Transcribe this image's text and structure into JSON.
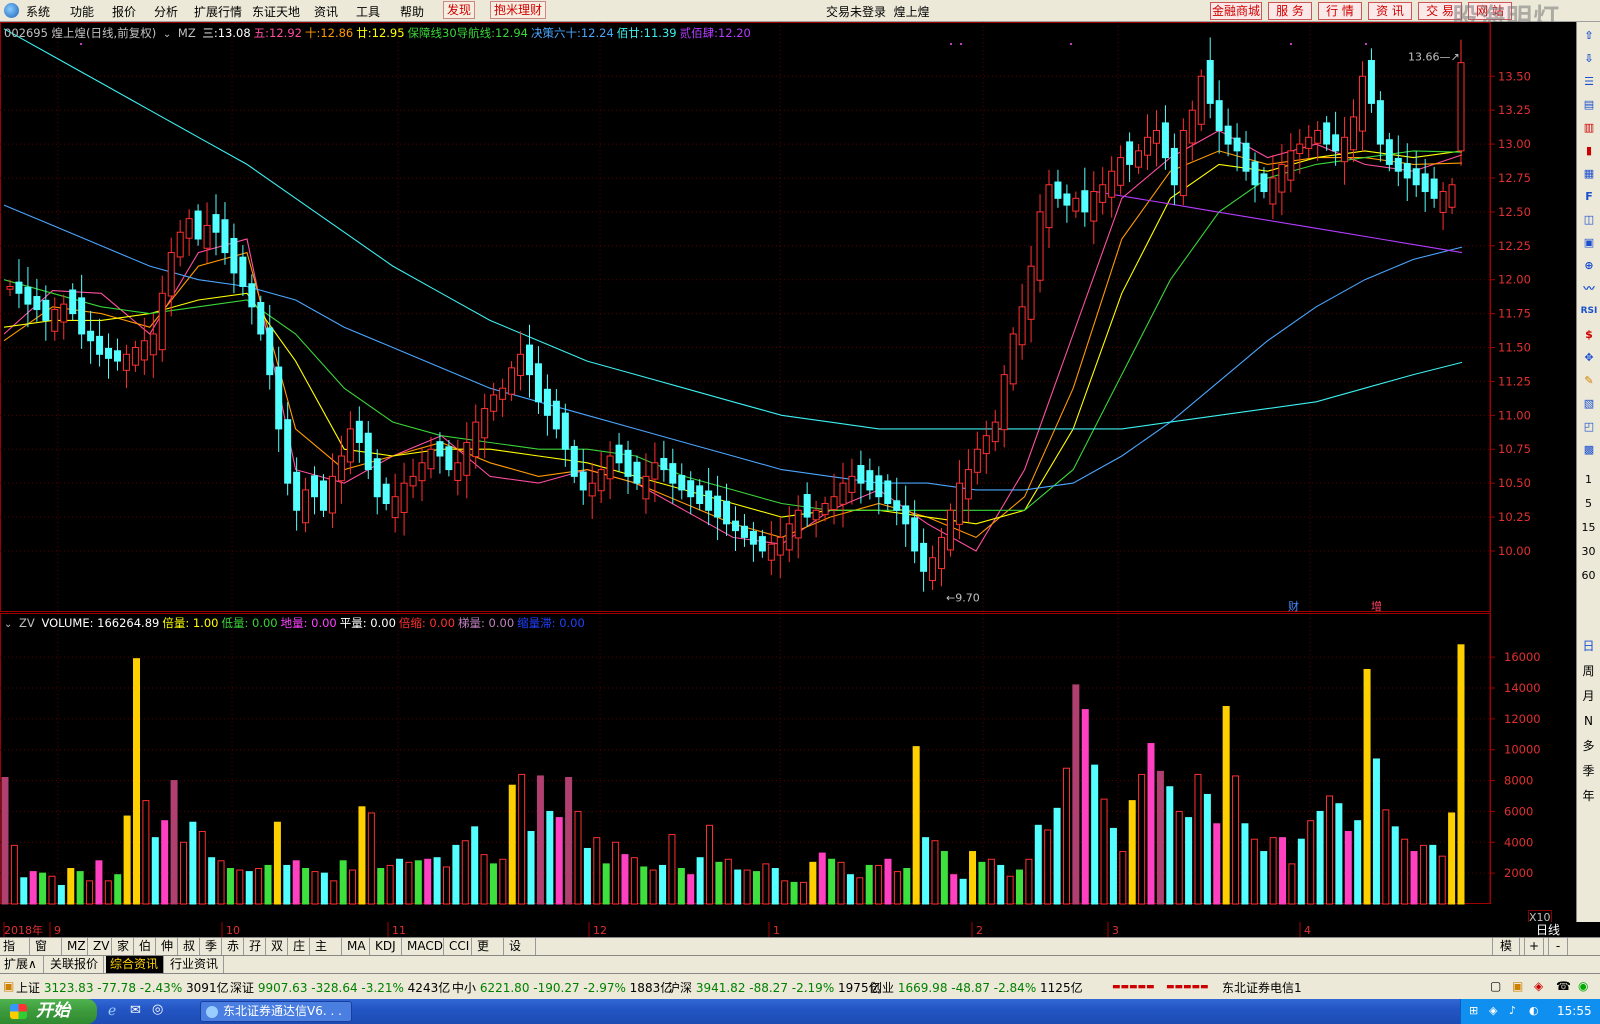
{
  "menu": {
    "items": [
      "系统",
      "功能",
      "报价",
      "分析",
      "扩展行情",
      "东证天地",
      "资讯",
      "工具",
      "帮助"
    ],
    "red_items": [
      "发现",
      "抱米理财"
    ],
    "login_status": "交易未登录",
    "stock_title": "煌上煌",
    "right_buttons": [
      "金融商城",
      "服 务",
      "行 情",
      "资 讯",
      "交 易",
      "网 站"
    ],
    "watermark": "股海明灯"
  },
  "price_legend": {
    "code_name": "002695 煌上煌(日线,前复权)",
    "indicator": "MZ",
    "items": [
      {
        "label": "三:",
        "value": "13.08",
        "color": "#ffffff"
      },
      {
        "label": "五:",
        "value": "12.92",
        "color": "#ff4fa0"
      },
      {
        "label": "十:",
        "value": "12.86",
        "color": "#ff9a00"
      },
      {
        "label": "廿:",
        "value": "12.95",
        "color": "#ffff00"
      },
      {
        "label": "保障线30导航线:",
        "value": "12.94",
        "color": "#39d539"
      },
      {
        "label": "决策六十:",
        "value": "12.24",
        "color": "#4aa6ff"
      },
      {
        "label": "佰廿:",
        "value": "11.39",
        "color": "#3cf0f0"
      },
      {
        "label": "贰佰肆:",
        "value": "12.20",
        "color": "#b43cff"
      }
    ]
  },
  "volume_legend": {
    "indicator": "ZV",
    "items": [
      {
        "label": "VOLUME:",
        "value": "166264.89",
        "color": "#ffffff"
      },
      {
        "label": "倍量:",
        "value": "1.00",
        "color": "#ffff00"
      },
      {
        "label": "低量:",
        "value": "0.00",
        "color": "#39d539"
      },
      {
        "label": "地量:",
        "value": "0.00",
        "color": "#ff40ff"
      },
      {
        "label": "平量:",
        "value": "0.00",
        "color": "#ffffff"
      },
      {
        "label": "倍缩:",
        "value": "0.00",
        "color": "#ff3030"
      },
      {
        "label": "梯量:",
        "value": "0.00",
        "color": "#c080c0"
      },
      {
        "label": "缩量滞:",
        "value": "0.00",
        "color": "#2040ff"
      }
    ],
    "multiplier": "X10"
  },
  "chart_data": [
    {
      "type": "candlestick",
      "title": "002695 煌上煌(日线,前复权)",
      "y_ticks": [
        "13.50",
        "13.25",
        "13.00",
        "12.75",
        "12.50",
        "12.25",
        "12.00",
        "11.75",
        "11.50",
        "11.25",
        "11.00",
        "10.75",
        "10.50",
        "10.25",
        "10.00"
      ],
      "ylim": [
        9.55,
        13.9
      ],
      "annotations": [
        {
          "text": "13.66",
          "price": 13.66
        },
        {
          "text": "9.70",
          "price": 9.7
        }
      ],
      "event_markers": [
        "财",
        "增"
      ],
      "closes": [
        11.95,
        11.9,
        11.82,
        11.78,
        11.7,
        11.78,
        11.82,
        11.75,
        11.6,
        11.55,
        11.45,
        11.42,
        11.4,
        11.45,
        11.5,
        11.55,
        11.6,
        11.9,
        12.2,
        12.35,
        12.45,
        12.3,
        12.4,
        12.35,
        12.2,
        12.05,
        11.95,
        11.8,
        11.6,
        11.3,
        10.9,
        10.5,
        10.3,
        10.45,
        10.4,
        10.3,
        10.55,
        10.7,
        10.9,
        10.8,
        10.6,
        10.4,
        10.35,
        10.4,
        10.5,
        10.55,
        10.65,
        10.75,
        10.7,
        10.6,
        10.65,
        10.8,
        10.95,
        11.05,
        11.15,
        11.2,
        11.35,
        11.45,
        11.3,
        11.1,
        11.0,
        10.9,
        10.75,
        10.55,
        10.45,
        10.5,
        10.6,
        10.7,
        10.65,
        10.55,
        10.5,
        10.55,
        10.65,
        10.6,
        10.5,
        10.45,
        10.4,
        10.35,
        10.3,
        10.25,
        10.2,
        10.15,
        10.1,
        10.05,
        10.0,
        10.05,
        10.1,
        10.2,
        10.3,
        10.25,
        10.3,
        10.35,
        10.4,
        10.5,
        10.55,
        10.5,
        10.45,
        10.4,
        10.35,
        10.3,
        10.2,
        10.0,
        9.85,
        9.95,
        10.1,
        10.3,
        10.5,
        10.6,
        10.75,
        10.85,
        10.95,
        11.3,
        11.6,
        11.8,
        12.1,
        12.5,
        12.7,
        12.6,
        12.55,
        12.6,
        12.5,
        12.65,
        12.7,
        12.8,
        12.9,
        12.85,
        12.95,
        13.05,
        13.1,
        12.9,
        12.7,
        13.1,
        13.25,
        13.5,
        13.3,
        13.1,
        13.0,
        12.95,
        12.8,
        12.7,
        12.65,
        12.75,
        12.85,
        12.95,
        13.0,
        13.05,
        13.1,
        13.0,
        12.95,
        13.05,
        13.2,
        13.5,
        13.3,
        13.0,
        12.85,
        12.8,
        12.75,
        12.7,
        12.65,
        12.6,
        12.65,
        12.7,
        13.6
      ],
      "ma_series": [
        {
          "name": "五",
          "values": [
            11.6,
            11.92,
            11.9,
            11.6,
            12.2,
            12.3,
            10.6,
            10.5,
            10.7,
            10.85,
            10.55,
            10.5,
            10.6,
            10.5,
            10.3,
            10.1,
            10.05,
            10.3,
            10.45,
            10.2,
            10.0,
            10.6,
            11.6,
            12.6,
            12.9,
            13.1,
            12.9,
            13.0,
            12.85,
            12.8,
            12.92
          ]
        },
        {
          "name": "十",
          "values": [
            11.55,
            11.8,
            11.75,
            11.65,
            12.1,
            12.2,
            10.9,
            10.6,
            10.7,
            10.8,
            10.65,
            10.55,
            10.6,
            10.5,
            10.35,
            10.2,
            10.1,
            10.25,
            10.35,
            10.25,
            10.1,
            10.4,
            11.2,
            12.3,
            12.8,
            12.95,
            12.85,
            12.9,
            12.9,
            12.85,
            12.86
          ]
        },
        {
          "name": "廿",
          "values": [
            11.65,
            11.7,
            11.7,
            11.75,
            11.85,
            11.9,
            11.4,
            10.75,
            10.7,
            10.75,
            10.75,
            10.7,
            10.65,
            10.55,
            10.45,
            10.35,
            10.25,
            10.3,
            10.3,
            10.25,
            10.2,
            10.3,
            10.9,
            11.9,
            12.6,
            12.85,
            12.8,
            12.9,
            12.95,
            12.9,
            12.95
          ]
        },
        {
          "name": "保障线30导航线",
          "values": [
            12.0,
            11.9,
            11.8,
            11.75,
            11.8,
            11.85,
            11.6,
            11.2,
            10.95,
            10.85,
            10.8,
            10.75,
            10.75,
            10.7,
            10.55,
            10.45,
            10.35,
            10.3,
            10.3,
            10.3,
            10.3,
            10.3,
            10.6,
            11.3,
            12.0,
            12.5,
            12.75,
            12.85,
            12.9,
            12.95,
            12.94
          ]
        },
        {
          "name": "决策六十",
          "values": [
            12.55,
            12.4,
            12.25,
            12.1,
            12.0,
            11.95,
            11.85,
            11.65,
            11.5,
            11.35,
            11.2,
            11.1,
            11.0,
            10.9,
            10.8,
            10.7,
            10.6,
            10.55,
            10.5,
            10.5,
            10.45,
            10.45,
            10.5,
            10.7,
            10.95,
            11.25,
            11.55,
            11.8,
            12.0,
            12.15,
            12.24
          ]
        },
        {
          "name": "佰廿",
          "values": [
            13.85,
            13.65,
            13.45,
            13.25,
            13.05,
            12.85,
            12.6,
            12.35,
            12.1,
            11.9,
            11.7,
            11.55,
            11.4,
            11.3,
            11.2,
            11.1,
            11.0,
            10.95,
            10.9,
            10.9,
            10.9,
            10.9,
            10.9,
            10.9,
            10.95,
            11.0,
            11.05,
            11.1,
            11.2,
            11.3,
            11.39
          ]
        },
        {
          "name": "贰佰肆",
          "values": [
            12.65,
            12.6,
            12.55,
            12.5,
            12.45,
            12.4,
            12.35,
            12.3,
            12.25,
            12.2
          ]
        }
      ]
    },
    {
      "type": "bar",
      "title": "VOLUME",
      "y_ticks": [
        "16000",
        "14000",
        "12000",
        "10000",
        "8000",
        "6000",
        "4000",
        "2000"
      ],
      "ylim": [
        0,
        17500
      ],
      "values": [
        8200,
        3800,
        1700,
        2100,
        2000,
        1800,
        1200,
        2300,
        2100,
        1500,
        2800,
        1500,
        1900,
        5700,
        15900,
        6700,
        4300,
        5400,
        8000,
        4000,
        5300,
        4700,
        3000,
        2800,
        2300,
        2200,
        2100,
        2300,
        2500,
        5300,
        2500,
        2800,
        2300,
        2100,
        2000,
        1500,
        2800,
        2200,
        6300,
        5900,
        2300,
        2500,
        2900,
        2700,
        2800,
        2900,
        3000,
        2400,
        3800,
        4100,
        5000,
        3200,
        2600,
        2900,
        7700,
        8400,
        4700,
        8300,
        6000,
        5600,
        8200,
        6000,
        3600,
        4300,
        2600,
        4000,
        3200,
        3000,
        2400,
        2200,
        2500,
        4500,
        2300,
        1900,
        3000,
        5100,
        2700,
        2900,
        2200,
        2200,
        2100,
        2600,
        2300,
        1500,
        1400,
        1400,
        2700,
        3300,
        2900,
        2700,
        1900,
        1700,
        2500,
        2500,
        2900,
        2100,
        2300,
        10200,
        4300,
        4100,
        3400,
        1900,
        1600,
        3400,
        2700,
        2900,
        2500,
        1800,
        2200,
        2900,
        5100,
        4800,
        6200,
        8800,
        14200,
        12600,
        9000,
        6800,
        4900,
        3400,
        6700,
        8400,
        10400,
        8600,
        7600,
        6000,
        5600,
        8400,
        7100,
        5200,
        12800,
        8300,
        5200,
        4200,
        3400,
        4300,
        4300,
        2600,
        4200,
        5400,
        6000,
        7000,
        6500,
        4700,
        5400,
        15200,
        9400,
        6100,
        5000,
        4200,
        3400,
        3800,
        3800,
        3100,
        5900,
        16800
      ]
    }
  ],
  "time_axis": {
    "labels": [
      "2018年",
      "9",
      "10",
      "11",
      "12",
      "1",
      "2",
      "3",
      "4"
    ],
    "period_label": "日线"
  },
  "right_periods": [
    "1",
    "5",
    "15",
    "30",
    "60",
    "日",
    "周",
    "月",
    "N",
    "多",
    "季",
    "年"
  ],
  "right_tools_icons": [
    "up-icon",
    "down-icon",
    "list-icon",
    "f10-icon",
    "bars-icon",
    "candles-icon",
    "orders-icon",
    "fundflow-icon",
    "chip-icon",
    "rsi-icon",
    "money-icon",
    "move-icon",
    "pen-icon"
  ],
  "bottom_tabs": [
    "指标",
    "窗口",
    "MZ",
    "ZV",
    "家",
    "伯",
    "伸",
    "叔",
    "季",
    "赤",
    "孖",
    "双",
    "庄",
    "主力",
    "MA",
    "KDJ",
    "MACD",
    "CCI",
    "更多",
    "设置"
  ],
  "bottom_right_tabs": [
    "模板",
    "+",
    "-"
  ],
  "info_tabs": [
    "扩展∧",
    "关联报价",
    "综合资讯",
    "行业资讯"
  ],
  "status": {
    "indices": [
      {
        "name": "上证",
        "value": "3123.83",
        "change": "-77.78",
        "pct": "-2.43%",
        "amount": "3091亿"
      },
      {
        "name": "深证",
        "value": "9907.63",
        "change": "-328.64",
        "pct": "-3.21%",
        "amount": "4243亿"
      },
      {
        "name": "中小",
        "value": "6221.80",
        "change": "-190.27",
        "pct": "-2.97%",
        "amount": "1883亿"
      },
      {
        "name": "沪深",
        "value": "3941.82",
        "change": "-88.27",
        "pct": "-2.19%",
        "amount": "1975亿"
      },
      {
        "name": "创业",
        "value": "1669.98",
        "change": "-48.87",
        "pct": "-2.84%",
        "amount": "1125亿"
      }
    ],
    "server": "东北证券电信1"
  },
  "taskbar": {
    "start": "开始",
    "task": "东北证券通达信V6. . .",
    "clock": "15:55"
  }
}
